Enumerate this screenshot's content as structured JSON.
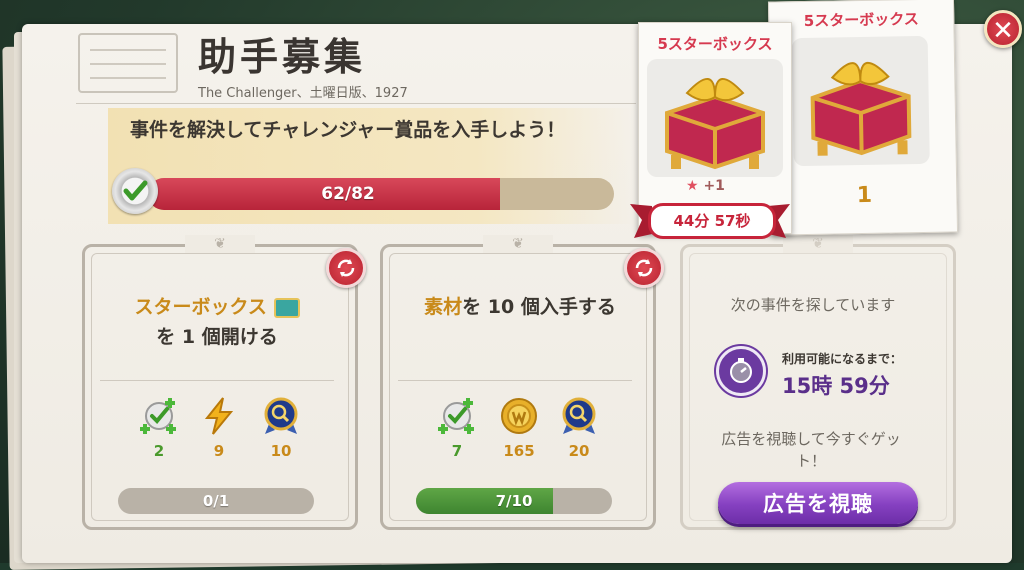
{
  "header": {
    "title": "助手募集",
    "subtitle": "The Challenger、土曜日版、1927"
  },
  "objective": {
    "text": "事件を解決してチャレンジャー賞品を入手しよう！",
    "progress_label": "62/82",
    "progress_current": 62,
    "progress_total": 82
  },
  "tasks": [
    {
      "title_highlight": "スターボックス",
      "title_rest": "を 1 個開ける",
      "rewards": [
        {
          "icon": "case-check-plus-icon",
          "value": "2",
          "color": "#4a9a2c"
        },
        {
          "icon": "energy-bolt-icon",
          "value": "9",
          "color": "#c98a1a"
        },
        {
          "icon": "magnifier-medal-icon",
          "value": "10",
          "color": "#c98a1a"
        }
      ],
      "progress_label": "0/1",
      "progress_fraction": 0.0
    },
    {
      "title_highlight": "素材",
      "title_rest": "を 10 個入手する",
      "rewards": [
        {
          "icon": "case-check-plus-icon",
          "value": "7",
          "color": "#4a9a2c"
        },
        {
          "icon": "gold-coin-icon",
          "value": "165",
          "color": "#c98a1a"
        },
        {
          "icon": "magnifier-medal-icon",
          "value": "20",
          "color": "#c98a1a"
        }
      ],
      "progress_label": "7/10",
      "progress_fraction": 0.7
    }
  ],
  "searching": {
    "status": "次の事件を探しています",
    "available_label": "利用可能になるまで：",
    "available_time": "15時 59分",
    "ad_hint": "広告を視聴して今すぐゲット！",
    "ad_button": "広告を視聴"
  },
  "chests": {
    "active": {
      "title": "5スターボックス",
      "bonus": "+1",
      "timer": "44分 57秒"
    },
    "stack": {
      "title": "5スターボックス",
      "count": "1"
    }
  },
  "colors": {
    "accent_red": "#c7243a",
    "gold": "#c98a1a",
    "purple": "#6b3aa0",
    "green": "#4a9a2c"
  }
}
